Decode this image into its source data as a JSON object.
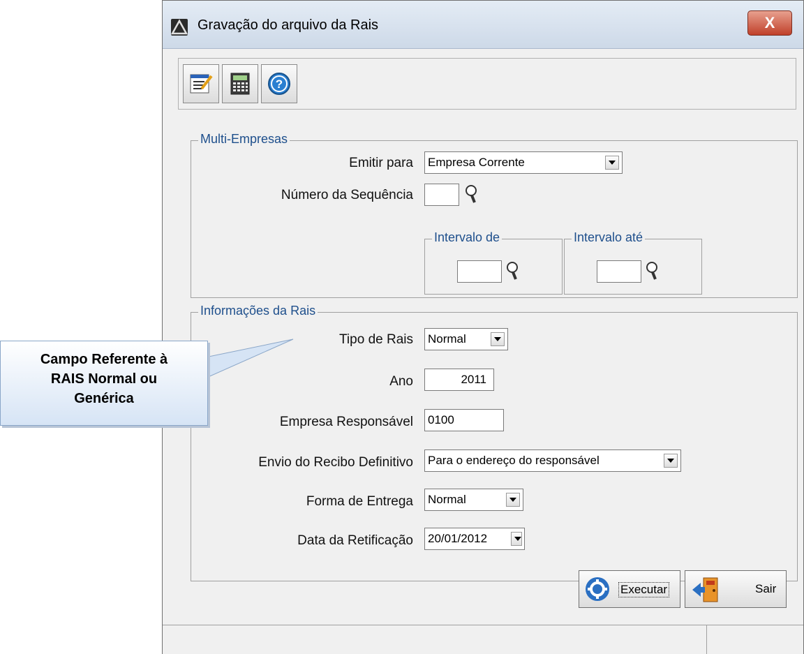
{
  "window": {
    "title": "Gravação do arquivo da Rais",
    "close_label": "X"
  },
  "toolbar": {
    "icons": [
      "edit-document-icon",
      "calculator-icon",
      "help-icon"
    ]
  },
  "multi_empresas": {
    "legend": "Multi-Empresas",
    "emitir_para_label": "Emitir para",
    "emitir_para_value": "Empresa Corrente",
    "numero_sequencia_label": "Número da Sequência",
    "numero_sequencia_value": "",
    "intervalo_de_legend": "Intervalo de",
    "intervalo_de_value": "",
    "intervalo_ate_legend": "Intervalo até",
    "intervalo_ate_value": ""
  },
  "informacoes": {
    "legend": "Informações da Rais",
    "tipo_label": "Tipo de Rais",
    "tipo_value": "Normal",
    "ano_label": "Ano",
    "ano_value": "2011",
    "empresa_label": "Empresa Responsável",
    "empresa_value": "0100",
    "envio_label": "Envio do Recibo Definitivo",
    "envio_value": "Para o endereço do responsável",
    "forma_label": "Forma de Entrega",
    "forma_value": "Normal",
    "data_label": "Data da Retificação",
    "data_value": "20/01/2012"
  },
  "buttons": {
    "executar": "Executar",
    "sair": "Sair"
  },
  "callout": {
    "line1": "Campo Referente à",
    "line2": "RAIS Normal ou",
    "line3": "Genérica"
  },
  "colors": {
    "legend": "#1e4f8c",
    "close": "#c0402a",
    "callout_bg": "#d6e4f5"
  }
}
